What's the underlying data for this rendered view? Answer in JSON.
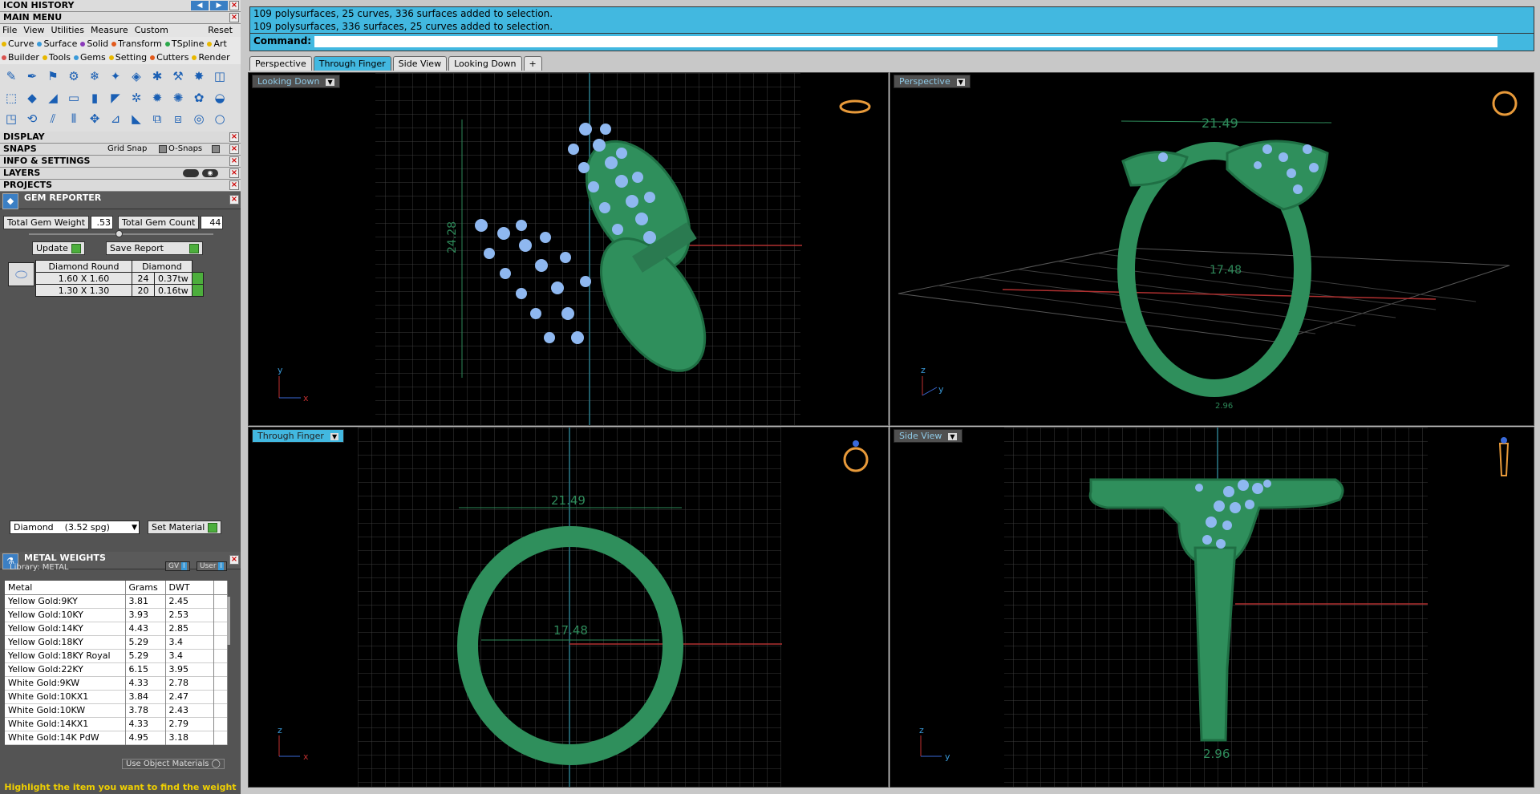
{
  "panel": {
    "icon_history": "ICON HISTORY",
    "main_menu": "MAIN MENU",
    "menus": [
      "File",
      "View",
      "Utilities",
      "Measure",
      "Custom",
      "Reset"
    ],
    "tabs1": [
      {
        "label": "Curve",
        "c": "#e8b800"
      },
      {
        "label": "Surface",
        "c": "#3a9ad9"
      },
      {
        "label": "Solid",
        "c": "#8a3ab9"
      },
      {
        "label": "Transform",
        "c": "#e25a1c"
      },
      {
        "label": "TSpline",
        "c": "#2aa84a"
      },
      {
        "label": "Art",
        "c": "#e8b800"
      }
    ],
    "tabs2": [
      {
        "label": "Builder",
        "c": "#d9534f"
      },
      {
        "label": "Tools",
        "c": "#e8b800"
      },
      {
        "label": "Gems",
        "c": "#3a9ad9"
      },
      {
        "label": "Setting",
        "c": "#e8b800"
      },
      {
        "label": "Cutters",
        "c": "#e25a1c"
      },
      {
        "label": "Render",
        "c": "#e8b800"
      }
    ],
    "display": "DISPLAY",
    "snaps": "SNAPS",
    "grid_snap": "Grid Snap",
    "osnaps": "O-Snaps",
    "info": "INFO & SETTINGS",
    "layers": "LAYERS",
    "projects": "PROJECTS"
  },
  "gem": {
    "title": "GEM REPORTER",
    "weight_label": "Total Gem Weight",
    "weight": ".53",
    "count_label": "Total Gem Count",
    "count": "44",
    "update": "Update",
    "save": "Save Report",
    "header": [
      "Diamond Round",
      "Diamond"
    ],
    "rows": [
      [
        "1.60 X 1.60",
        "24",
        "0.37tw"
      ],
      [
        "1.30 X 1.30",
        "20",
        "0.16tw"
      ]
    ],
    "material": "Diamond    (3.52 spg)",
    "set_material": "Set Material"
  },
  "metal": {
    "title": "METAL WEIGHTS",
    "library": "Library: METAL",
    "gv": "GV",
    "user": "User",
    "cols": [
      "Metal",
      "Grams",
      "DWT"
    ],
    "rows": [
      [
        "Yellow Gold:9KY",
        "3.81",
        "2.45"
      ],
      [
        "Yellow Gold:10KY",
        "3.93",
        "2.53"
      ],
      [
        "Yellow Gold:14KY",
        "4.43",
        "2.85"
      ],
      [
        "Yellow Gold:18KY",
        "5.29",
        "3.4"
      ],
      [
        "Yellow Gold:18KY Royal",
        "5.29",
        "3.4"
      ],
      [
        "Yellow Gold:22KY",
        "6.15",
        "3.95"
      ],
      [
        "White Gold:9KW",
        "4.33",
        "2.78"
      ],
      [
        "White Gold:10KX1",
        "3.84",
        "2.47"
      ],
      [
        "White Gold:10KW",
        "3.78",
        "2.43"
      ],
      [
        "White Gold:14KX1",
        "4.33",
        "2.79"
      ],
      [
        "White Gold:14K PdW",
        "4.95",
        "3.18"
      ]
    ],
    "use_obj": "Use Object Materials",
    "hint": "Highlight the item you want to find the weight"
  },
  "cmd": {
    "line1": "109 polysurfaces, 25 curves, 336 surfaces added to selection.",
    "line2": "109 polysurfaces, 336 surfaces, 25 curves added to selection.",
    "label": "Command:"
  },
  "view_tabs": [
    "Perspective",
    "Through Finger",
    "Side View",
    "Looking Down",
    "+"
  ],
  "viewports": {
    "tl": {
      "label": "Looking Down",
      "dim": "24.28",
      "ax1": "y",
      "ax2": "x"
    },
    "tr": {
      "label": "Perspective",
      "dim1": "21.49",
      "dim2": "17.48",
      "dim3": "2.96",
      "ax1": "z",
      "ax2": "y"
    },
    "bl": {
      "label": "Through Finger",
      "dim1": "21.49",
      "dim2": "17.48",
      "ax1": "z",
      "ax2": "x"
    },
    "br": {
      "label": "Side View",
      "dim": "2.96",
      "ax1": "z",
      "ax2": "y"
    }
  },
  "colors": {
    "accent": "#42b8e0",
    "metal": "#2f8f5c",
    "gem": "#8fb8f0",
    "panel": "#545454"
  }
}
